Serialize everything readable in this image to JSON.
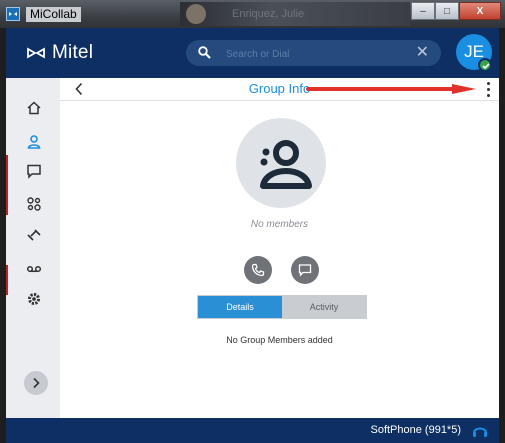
{
  "window": {
    "title": "MiCollab",
    "blurred_text": "Enriquez, Julie",
    "controls": {
      "minimize": "–",
      "maximize": "□",
      "close": "X"
    }
  },
  "header": {
    "logo_text": "Mitel",
    "search": {
      "placeholder": "Search or Dial",
      "value": ""
    },
    "clear_symbol": "✕",
    "avatar_initials": "JE",
    "status": "available"
  },
  "sidebar": {
    "items": [
      {
        "icon": "home-icon"
      },
      {
        "icon": "contacts-icon",
        "active": true
      },
      {
        "icon": "chat-icon"
      },
      {
        "icon": "teams-icon"
      },
      {
        "icon": "call-history-icon"
      },
      {
        "icon": "voicemail-icon"
      },
      {
        "icon": "settings-icon"
      }
    ],
    "expand_icon": "chevron-right-icon"
  },
  "main": {
    "back_icon": "chevron-left-icon",
    "title": "Group Info",
    "menu_icon": "kebab-menu-icon",
    "no_members": "No members",
    "actions": [
      {
        "icon": "phone-icon"
      },
      {
        "icon": "message-icon"
      }
    ],
    "tabs": [
      {
        "label": "Details",
        "active": true
      },
      {
        "label": "Activity",
        "active": false
      }
    ],
    "empty_message": "No Group Members added"
  },
  "footer": {
    "softphone": "SoftPhone (991*5)",
    "icon": "headset-icon"
  },
  "colors": {
    "brand_navy": "#0d2f63",
    "accent_blue": "#1a8ee0",
    "annotation_red": "#e0322a",
    "status_green": "#3aa34a"
  }
}
